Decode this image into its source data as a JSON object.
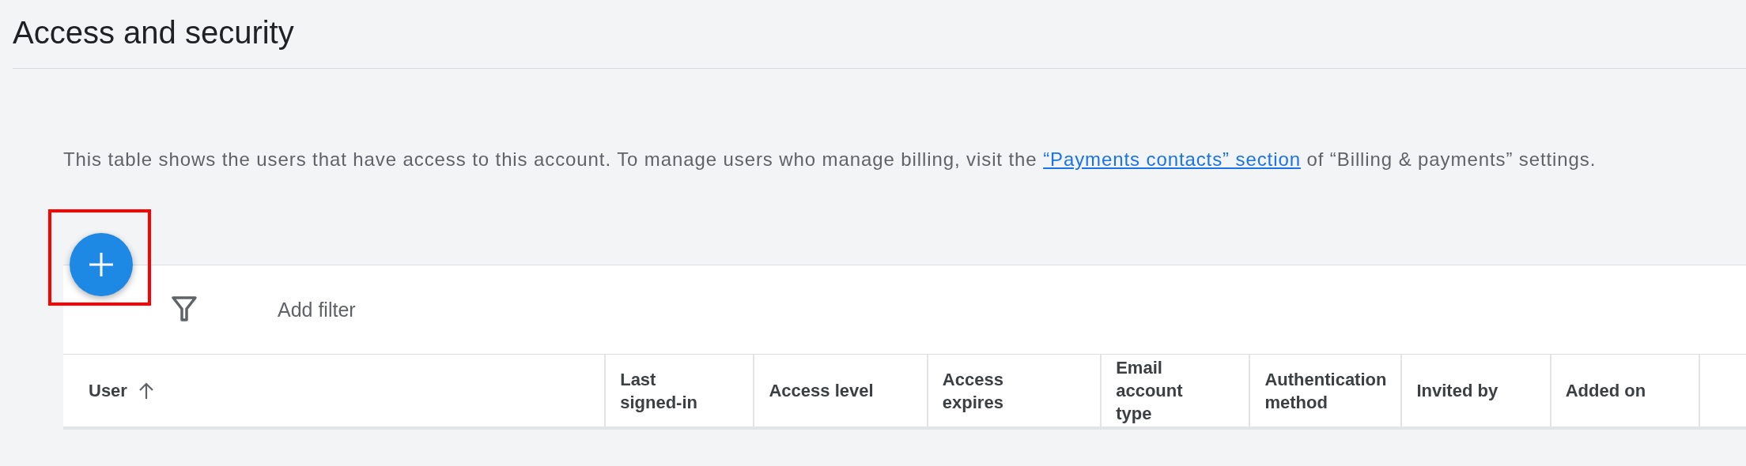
{
  "page": {
    "title": "Access and security"
  },
  "description": {
    "before": "This table shows the users that have access to this account. To manage users who manage billing, visit the ",
    "link": "“Payments contacts” section",
    "after": " of “Billing & payments” settings."
  },
  "add_button": {
    "highlighted": true
  },
  "filter": {
    "label": "Add filter"
  },
  "table": {
    "columns": [
      {
        "label": "User",
        "sorted": true
      },
      {
        "label": "Last signed-in"
      },
      {
        "label": "Access level"
      },
      {
        "label": "Access expires"
      },
      {
        "label": "Email account type"
      },
      {
        "label": "Authentication method"
      },
      {
        "label": "Invited by"
      },
      {
        "label": "Added on"
      }
    ]
  }
}
